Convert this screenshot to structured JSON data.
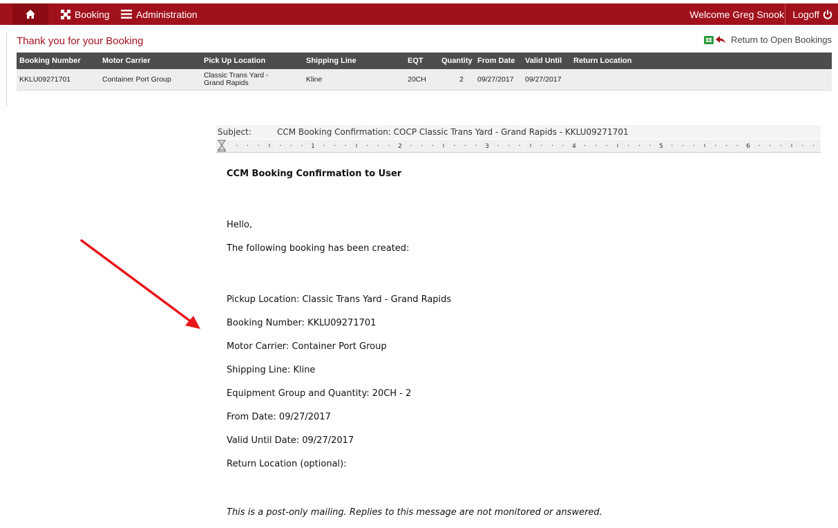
{
  "nav": {
    "booking_label": "Booking",
    "administration_label": "Administration",
    "welcome_text": "Welcome Greg Snook",
    "logoff_label": "Logoff"
  },
  "page": {
    "title": "Thank you for your Booking",
    "return_label": "Return to Open Bookings"
  },
  "table": {
    "headers": [
      "Booking Number",
      "Motor Carrier",
      "Pick Up Location",
      "Shipping Line",
      "EQT",
      "Quantity",
      "From Date",
      "Valid Until",
      "Return Location"
    ],
    "rows": [
      [
        "KKLU09271701",
        "Container Port Group",
        "Classic Trans Yard - Grand Rapids",
        "Kline",
        "20CH",
        "2",
        "09/27/2017",
        "09/27/2017",
        ""
      ]
    ]
  },
  "email": {
    "subject_label": "Subject:",
    "subject_value": "CCM Booking Confirmation: COCP Classic Trans Yard - Grand Rapids - KKLU09271701",
    "ruler_numbers": [
      "1",
      "2",
      "3",
      "4",
      "5",
      "6"
    ],
    "heading": "CCM Booking Confirmation to User",
    "greeting": "Hello,",
    "intro": "The following booking has been created:",
    "lines": [
      "Pickup Location: Classic Trans Yard - Grand Rapids",
      "Booking Number: KKLU09271701",
      "Motor Carrier: Container Port Group",
      "Shipping Line: Kline",
      "Equipment Group and Quantity: 20CH - 2",
      "From Date: 09/27/2017",
      "Valid Until Date: 09/27/2017",
      "Return Location (optional):"
    ],
    "footer": "This is a post-only mailing.  Replies to this message are not monitored or answered."
  },
  "colors": {
    "brand": "#a1111c",
    "table_header": "#4d4d4d",
    "annotation_arrow": "#e8141a"
  }
}
